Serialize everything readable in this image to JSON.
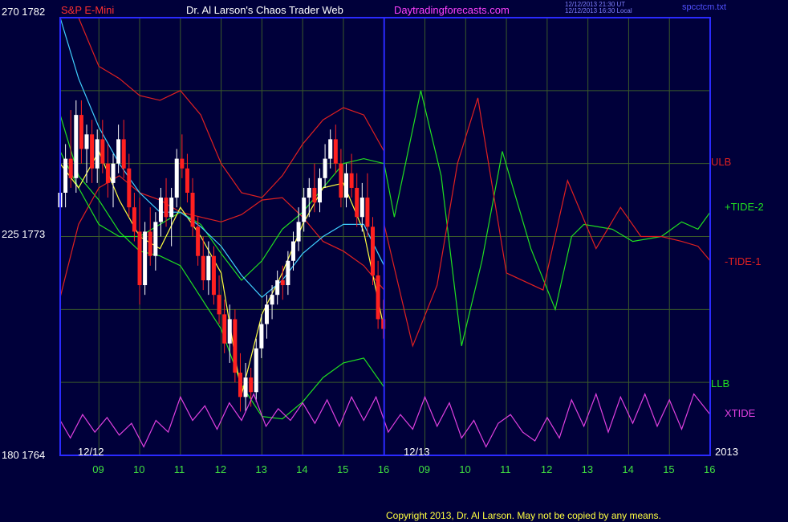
{
  "header": {
    "symbol": "S&P E-Mini",
    "title": "Dr. Al Larson's Chaos Trader Web",
    "site": "Daytradingforecasts.com",
    "stamp_line1": "12/12/2013 21:30 UT",
    "stamp_line2": "12/12/2013 16:30 Local",
    "file": "spcctcm.txt"
  },
  "axis_left": {
    "top": "270  1782",
    "mid": "225  1773",
    "bottom": "180  1764"
  },
  "dates": {
    "d1": "12/12",
    "d2": "12/13",
    "year": "2013"
  },
  "labels": {
    "ulb": "ULB",
    "tide2": "+TIDE-2",
    "tide1": "-TIDE-1",
    "llb": "LLB",
    "xtide": "XTIDE"
  },
  "footer": {
    "copyright": "Copyright 2013, Dr. Al Larson. May not be copied by any means."
  },
  "colors": {
    "background": "#00003a",
    "frame": "#2a2aff",
    "grid": "#3a5a2a",
    "ulb": "#e02020",
    "tide2": "#20e020",
    "xtide": "#e040e0",
    "ma_fast": "#ffff40",
    "ma_slow": "#40d0ff",
    "candle_down": "#ff2020",
    "candle_up": "#ffffff",
    "axis_text": "#40e040"
  },
  "chart_data": {
    "type": "line",
    "title": "Dr. Al Larson's Chaos Trader Web",
    "ylabel": "S&P E-Mini",
    "y_price_range": [
      1764,
      1782
    ],
    "y_index_range": [
      180,
      270
    ],
    "x_tick_labels": [
      "09",
      "10",
      "11",
      "12",
      "13",
      "14",
      "15",
      "16",
      "09",
      "10",
      "11",
      "12",
      "13",
      "14",
      "15",
      "16"
    ],
    "x_range": [
      8.05,
      24.0
    ],
    "day_divider": 16.0,
    "series": [
      {
        "name": "ULB",
        "x": [
          8.05,
          8.5,
          9.0,
          9.5,
          10.0,
          10.5,
          11.0,
          11.5,
          12.0,
          12.5,
          13.0,
          13.5,
          14.0,
          14.5,
          15.0,
          15.5,
          16.0
        ],
        "values": [
          1790,
          1782,
          1780,
          1779.5,
          1778.8,
          1778.6,
          1779,
          1778,
          1776,
          1774.8,
          1774.6,
          1775.5,
          1776.8,
          1777.8,
          1778.3,
          1778,
          1776.5
        ]
      },
      {
        "name": "LLB",
        "x": [
          8.05,
          8.5,
          9.0,
          9.5,
          10.0,
          10.5,
          11.0,
          11.5,
          12.0,
          12.5,
          13.0,
          13.5,
          14.0,
          14.5,
          15.0,
          15.5,
          16.0
        ],
        "values": [
          1778,
          1775.5,
          1774.5,
          1773.2,
          1772.4,
          1772.2,
          1771.8,
          1770.5,
          1769.2,
          1766.9,
          1765.6,
          1765.5,
          1766.2,
          1767.2,
          1767.8,
          1768,
          1766.8
        ]
      },
      {
        "name": "Mid Band",
        "x": [
          8.05,
          8.5,
          9.0,
          9.5,
          10.0,
          10.5,
          11.0,
          11.5,
          12.0,
          12.5,
          13.0,
          13.5,
          14.0,
          14.5,
          15.0,
          15.5,
          16.0
        ],
        "values": [
          1770.5,
          1773.5,
          1775,
          1775.5,
          1774.8,
          1774.5,
          1774,
          1773.8,
          1773.6,
          1773.9,
          1774.5,
          1774.6,
          1773.8,
          1772.8,
          1772.4,
          1771.8,
          1770.8
        ]
      },
      {
        "name": "+TIDE-2",
        "x": [
          8.05,
          8.5,
          9.0,
          9.5,
          10.0,
          10.5,
          11.0,
          11.5,
          12.0,
          12.5,
          13.0,
          13.5,
          14.0,
          14.5,
          15.0,
          15.5,
          16.0,
          16.25,
          16.9,
          17.4,
          17.9,
          18.4,
          18.9,
          19.6,
          20.2,
          20.6,
          20.9,
          21.6,
          22.1,
          22.8,
          23.3,
          23.7,
          24.0
        ],
        "values": [
          1776.5,
          1775,
          1773.5,
          1773,
          1773,
          1773.5,
          1774,
          1773.5,
          1772.3,
          1771.2,
          1772,
          1773.3,
          1774,
          1775,
          1776,
          1776.2,
          1776,
          1773.8,
          1779,
          1775.5,
          1768.5,
          1772,
          1776.5,
          1772.5,
          1770,
          1773,
          1773.5,
          1773.3,
          1772.8,
          1773,
          1773.6,
          1773.3,
          1774
        ]
      },
      {
        "name": "-TIDE-1",
        "x": [
          16.0,
          16.7,
          17.3,
          17.8,
          18.3,
          19.0,
          19.9,
          20.5,
          21.2,
          21.8,
          22.3,
          22.8,
          23.3,
          23.7,
          24.0
        ],
        "values": [
          1773.5,
          1768.5,
          1771,
          1776,
          1778.7,
          1771.5,
          1770.8,
          1775.3,
          1772.5,
          1774.2,
          1773,
          1773,
          1772.8,
          1772.6,
          1772
        ]
      },
      {
        "name": "Fast MA",
        "x": [
          8.05,
          8.5,
          9.0,
          9.5,
          10.0,
          10.5,
          11.0,
          11.5,
          12.0,
          12.5,
          13.0,
          13.5,
          14.0,
          14.5,
          15.0,
          15.5,
          16.0
        ],
        "values": [
          1776,
          1775,
          1776.5,
          1774.5,
          1773,
          1772.5,
          1774.2,
          1773,
          1771.5,
          1766.5,
          1769.8,
          1771.5,
          1773.5,
          1775,
          1775.2,
          1773.2,
          1769.2
        ]
      },
      {
        "name": "Slow MA",
        "x": [
          8.05,
          8.5,
          9.0,
          9.5,
          10.0,
          10.5,
          11.0,
          11.5,
          12.0,
          12.5,
          13.0,
          13.5,
          14.0,
          14.5,
          15.0,
          15.5,
          16.0
        ],
        "values": [
          1782,
          1779.5,
          1777.5,
          1776,
          1774.8,
          1774,
          1774,
          1773.4,
          1772.6,
          1771.4,
          1770.5,
          1771.2,
          1772.3,
          1773,
          1773.5,
          1773.5,
          1771.8
        ]
      }
    ],
    "xtide": {
      "name": "XTIDE",
      "x": [
        8.05,
        8.3,
        8.6,
        8.9,
        9.2,
        9.5,
        9.8,
        10.1,
        10.4,
        10.7,
        11.0,
        11.3,
        11.6,
        11.9,
        12.2,
        12.5,
        12.8,
        13.1,
        13.4,
        13.7,
        14.0,
        14.3,
        14.6,
        14.9,
        15.2,
        15.5,
        15.8,
        16.1,
        16.4,
        16.7,
        17.0,
        17.3,
        17.6,
        17.9,
        18.2,
        18.5,
        18.8,
        19.1,
        19.4,
        19.7,
        20.0,
        20.3,
        20.6,
        20.9,
        21.2,
        21.5,
        21.8,
        22.1,
        22.4,
        22.7,
        23.0,
        23.3,
        23.6,
        24.0
      ],
      "values": [
        0.5,
        0.2,
        0.6,
        0.3,
        0.55,
        0.25,
        0.45,
        0.05,
        0.5,
        0.3,
        0.9,
        0.5,
        0.75,
        0.35,
        0.8,
        0.5,
        0.95,
        0.4,
        0.7,
        0.5,
        0.8,
        0.45,
        0.85,
        0.4,
        0.9,
        0.5,
        0.9,
        0.3,
        0.6,
        0.35,
        0.9,
        0.4,
        0.8,
        0.2,
        0.5,
        0.05,
        0.45,
        0.6,
        0.3,
        0.15,
        0.55,
        0.2,
        0.85,
        0.4,
        0.95,
        0.3,
        0.9,
        0.45,
        0.95,
        0.4,
        0.85,
        0.35,
        0.95,
        0.6
      ]
    },
    "candles": [
      {
        "x": 8.05,
        "o": 1774.2,
        "h": 1775.2,
        "l": 1773.8,
        "c": 1774.8
      },
      {
        "x": 8.18,
        "o": 1774.8,
        "h": 1776.8,
        "l": 1774.2,
        "c": 1776.2
      },
      {
        "x": 8.31,
        "o": 1776.2,
        "h": 1778.2,
        "l": 1775.0,
        "c": 1775.4
      },
      {
        "x": 8.44,
        "o": 1775.4,
        "h": 1778.6,
        "l": 1774.8,
        "c": 1778.0
      },
      {
        "x": 8.57,
        "o": 1778.0,
        "h": 1778.6,
        "l": 1776.0,
        "c": 1776.6
      },
      {
        "x": 8.7,
        "o": 1776.6,
        "h": 1777.6,
        "l": 1775.2,
        "c": 1777.2
      },
      {
        "x": 8.83,
        "o": 1777.2,
        "h": 1777.8,
        "l": 1775.2,
        "c": 1775.8
      },
      {
        "x": 8.96,
        "o": 1775.8,
        "h": 1777.4,
        "l": 1775.2,
        "c": 1777.0
      },
      {
        "x": 9.09,
        "o": 1777.0,
        "h": 1777.8,
        "l": 1775.6,
        "c": 1776.0
      },
      {
        "x": 9.22,
        "o": 1776.0,
        "h": 1776.8,
        "l": 1774.6,
        "c": 1775.2
      },
      {
        "x": 9.35,
        "o": 1775.2,
        "h": 1776.4,
        "l": 1774.2,
        "c": 1776.0
      },
      {
        "x": 9.48,
        "o": 1776.0,
        "h": 1777.6,
        "l": 1775.6,
        "c": 1777.0
      },
      {
        "x": 9.61,
        "o": 1777.0,
        "h": 1777.8,
        "l": 1775.4,
        "c": 1775.8
      },
      {
        "x": 9.74,
        "o": 1775.8,
        "h": 1776.4,
        "l": 1773.8,
        "c": 1774.2
      },
      {
        "x": 9.87,
        "o": 1774.2,
        "h": 1774.8,
        "l": 1772.8,
        "c": 1773.2
      },
      {
        "x": 10.0,
        "o": 1773.2,
        "h": 1774.6,
        "l": 1770.2,
        "c": 1771.0
      },
      {
        "x": 10.13,
        "o": 1771.0,
        "h": 1773.6,
        "l": 1770.6,
        "c": 1773.2
      },
      {
        "x": 10.26,
        "o": 1773.2,
        "h": 1774.2,
        "l": 1771.8,
        "c": 1772.2
      },
      {
        "x": 10.39,
        "o": 1772.2,
        "h": 1774.0,
        "l": 1771.6,
        "c": 1773.6
      },
      {
        "x": 10.52,
        "o": 1773.6,
        "h": 1775.0,
        "l": 1773.0,
        "c": 1774.6
      },
      {
        "x": 10.65,
        "o": 1774.6,
        "h": 1775.4,
        "l": 1773.4,
        "c": 1773.8
      },
      {
        "x": 10.78,
        "o": 1773.8,
        "h": 1775.0,
        "l": 1772.6,
        "c": 1774.6
      },
      {
        "x": 10.91,
        "o": 1774.6,
        "h": 1776.6,
        "l": 1774.2,
        "c": 1776.2
      },
      {
        "x": 11.04,
        "o": 1776.2,
        "h": 1777.2,
        "l": 1775.4,
        "c": 1775.8
      },
      {
        "x": 11.17,
        "o": 1775.8,
        "h": 1776.4,
        "l": 1774.4,
        "c": 1774.8
      },
      {
        "x": 11.3,
        "o": 1774.8,
        "h": 1775.4,
        "l": 1773.0,
        "c": 1773.4
      },
      {
        "x": 11.43,
        "o": 1773.4,
        "h": 1773.8,
        "l": 1771.8,
        "c": 1772.2
      },
      {
        "x": 11.56,
        "o": 1772.2,
        "h": 1773.0,
        "l": 1770.8,
        "c": 1771.2
      },
      {
        "x": 11.69,
        "o": 1771.2,
        "h": 1772.8,
        "l": 1770.6,
        "c": 1772.2
      },
      {
        "x": 11.82,
        "o": 1772.2,
        "h": 1772.6,
        "l": 1770.2,
        "c": 1770.6
      },
      {
        "x": 11.95,
        "o": 1770.6,
        "h": 1771.4,
        "l": 1769.4,
        "c": 1769.8
      },
      {
        "x": 12.08,
        "o": 1769.8,
        "h": 1770.4,
        "l": 1768.2,
        "c": 1768.6
      },
      {
        "x": 12.21,
        "o": 1768.6,
        "h": 1770.2,
        "l": 1767.8,
        "c": 1769.6
      },
      {
        "x": 12.34,
        "o": 1769.6,
        "h": 1770.0,
        "l": 1767.0,
        "c": 1767.4
      },
      {
        "x": 12.47,
        "o": 1767.4,
        "h": 1768.2,
        "l": 1765.8,
        "c": 1766.4
      },
      {
        "x": 12.6,
        "o": 1766.4,
        "h": 1767.8,
        "l": 1765.8,
        "c": 1767.2
      },
      {
        "x": 12.73,
        "o": 1767.2,
        "h": 1767.6,
        "l": 1766.0,
        "c": 1766.6
      },
      {
        "x": 12.86,
        "o": 1766.6,
        "h": 1768.8,
        "l": 1766.2,
        "c": 1768.4
      },
      {
        "x": 12.99,
        "o": 1768.4,
        "h": 1769.8,
        "l": 1768.0,
        "c": 1769.4
      },
      {
        "x": 13.12,
        "o": 1769.4,
        "h": 1770.6,
        "l": 1768.8,
        "c": 1770.2
      },
      {
        "x": 13.25,
        "o": 1770.2,
        "h": 1771.0,
        "l": 1769.6,
        "c": 1770.6
      },
      {
        "x": 13.38,
        "o": 1770.6,
        "h": 1771.6,
        "l": 1770.2,
        "c": 1771.2
      },
      {
        "x": 13.51,
        "o": 1771.2,
        "h": 1771.8,
        "l": 1770.4,
        "c": 1771.0
      },
      {
        "x": 13.64,
        "o": 1771.0,
        "h": 1772.4,
        "l": 1770.6,
        "c": 1772.0
      },
      {
        "x": 13.77,
        "o": 1772.0,
        "h": 1773.2,
        "l": 1771.6,
        "c": 1772.8
      },
      {
        "x": 13.9,
        "o": 1772.8,
        "h": 1774.2,
        "l": 1772.4,
        "c": 1773.6
      },
      {
        "x": 14.03,
        "o": 1773.6,
        "h": 1775.0,
        "l": 1773.2,
        "c": 1774.6
      },
      {
        "x": 14.16,
        "o": 1774.6,
        "h": 1775.4,
        "l": 1773.8,
        "c": 1775.0
      },
      {
        "x": 14.29,
        "o": 1775.0,
        "h": 1776.0,
        "l": 1774.0,
        "c": 1774.4
      },
      {
        "x": 14.42,
        "o": 1774.4,
        "h": 1775.8,
        "l": 1774.0,
        "c": 1775.4
      },
      {
        "x": 14.55,
        "o": 1775.4,
        "h": 1776.8,
        "l": 1775.0,
        "c": 1776.2
      },
      {
        "x": 14.68,
        "o": 1776.2,
        "h": 1777.4,
        "l": 1775.8,
        "c": 1777.0
      },
      {
        "x": 14.81,
        "o": 1777.0,
        "h": 1777.6,
        "l": 1775.6,
        "c": 1776.0
      },
      {
        "x": 14.94,
        "o": 1776.0,
        "h": 1776.6,
        "l": 1774.2,
        "c": 1774.6
      },
      {
        "x": 15.07,
        "o": 1774.6,
        "h": 1776.0,
        "l": 1774.2,
        "c": 1775.6
      },
      {
        "x": 15.2,
        "o": 1775.6,
        "h": 1776.4,
        "l": 1774.6,
        "c": 1775.0
      },
      {
        "x": 15.33,
        "o": 1775.0,
        "h": 1775.6,
        "l": 1773.4,
        "c": 1773.8
      },
      {
        "x": 15.46,
        "o": 1773.8,
        "h": 1775.2,
        "l": 1773.2,
        "c": 1774.6
      },
      {
        "x": 15.59,
        "o": 1774.6,
        "h": 1775.6,
        "l": 1773.0,
        "c": 1773.4
      },
      {
        "x": 15.72,
        "o": 1773.4,
        "h": 1773.8,
        "l": 1771.0,
        "c": 1771.4
      },
      {
        "x": 15.85,
        "o": 1771.4,
        "h": 1772.0,
        "l": 1769.2,
        "c": 1769.6
      },
      {
        "x": 15.98,
        "o": 1769.6,
        "h": 1770.4,
        "l": 1768.8,
        "c": 1769.2
      }
    ]
  }
}
